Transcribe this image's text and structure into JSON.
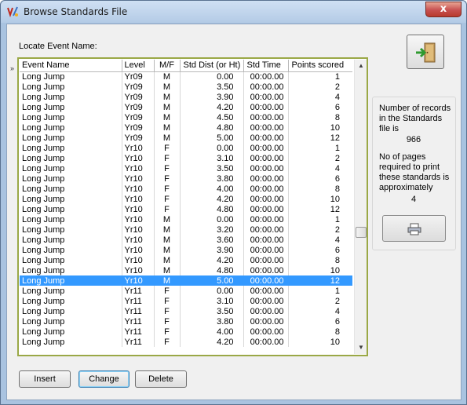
{
  "window": {
    "title": "Browse Standards File",
    "close_glyph": "x"
  },
  "locate": {
    "label": "Locate Event Name:"
  },
  "grid": {
    "columns": [
      "Event Name",
      "Level",
      "M/F",
      "Std Dist (or Ht)",
      "Std Time",
      "Points scored"
    ],
    "row_indicator": "»",
    "selected_index": 20,
    "rows": [
      [
        "Long Jump",
        "Yr09",
        "M",
        "0.00",
        "00:00.00",
        "1"
      ],
      [
        "Long Jump",
        "Yr09",
        "M",
        "3.50",
        "00:00.00",
        "2"
      ],
      [
        "Long Jump",
        "Yr09",
        "M",
        "3.90",
        "00:00.00",
        "4"
      ],
      [
        "Long Jump",
        "Yr09",
        "M",
        "4.20",
        "00:00.00",
        "6"
      ],
      [
        "Long Jump",
        "Yr09",
        "M",
        "4.50",
        "00:00.00",
        "8"
      ],
      [
        "Long Jump",
        "Yr09",
        "M",
        "4.80",
        "00:00.00",
        "10"
      ],
      [
        "Long Jump",
        "Yr09",
        "M",
        "5.00",
        "00:00.00",
        "12"
      ],
      [
        "Long Jump",
        "Yr10",
        "F",
        "0.00",
        "00:00.00",
        "1"
      ],
      [
        "Long Jump",
        "Yr10",
        "F",
        "3.10",
        "00:00.00",
        "2"
      ],
      [
        "Long Jump",
        "Yr10",
        "F",
        "3.50",
        "00:00.00",
        "4"
      ],
      [
        "Long Jump",
        "Yr10",
        "F",
        "3.80",
        "00:00.00",
        "6"
      ],
      [
        "Long Jump",
        "Yr10",
        "F",
        "4.00",
        "00:00.00",
        "8"
      ],
      [
        "Long Jump",
        "Yr10",
        "F",
        "4.20",
        "00:00.00",
        "10"
      ],
      [
        "Long Jump",
        "Yr10",
        "F",
        "4.80",
        "00:00.00",
        "12"
      ],
      [
        "Long Jump",
        "Yr10",
        "M",
        "0.00",
        "00:00.00",
        "1"
      ],
      [
        "Long Jump",
        "Yr10",
        "M",
        "3.20",
        "00:00.00",
        "2"
      ],
      [
        "Long Jump",
        "Yr10",
        "M",
        "3.60",
        "00:00.00",
        "4"
      ],
      [
        "Long Jump",
        "Yr10",
        "M",
        "3.90",
        "00:00.00",
        "6"
      ],
      [
        "Long Jump",
        "Yr10",
        "M",
        "4.20",
        "00:00.00",
        "8"
      ],
      [
        "Long Jump",
        "Yr10",
        "M",
        "4.80",
        "00:00.00",
        "10"
      ],
      [
        "Long Jump",
        "Yr10",
        "M",
        "5.00",
        "00:00.00",
        "12"
      ],
      [
        "Long Jump",
        "Yr11",
        "F",
        "0.00",
        "00:00.00",
        "1"
      ],
      [
        "Long Jump",
        "Yr11",
        "F",
        "3.10",
        "00:00.00",
        "2"
      ],
      [
        "Long Jump",
        "Yr11",
        "F",
        "3.50",
        "00:00.00",
        "4"
      ],
      [
        "Long Jump",
        "Yr11",
        "F",
        "3.80",
        "00:00.00",
        "6"
      ],
      [
        "Long Jump",
        "Yr11",
        "F",
        "4.00",
        "00:00.00",
        "8"
      ],
      [
        "Long Jump",
        "Yr11",
        "F",
        "4.20",
        "00:00.00",
        "10"
      ]
    ],
    "scroll_position": 0.6
  },
  "info": {
    "records_text": "Number of records in the Standards file is",
    "records_count": "966",
    "pages_text": "No of pages required to print these standards is approximately",
    "pages_count": "4"
  },
  "buttons": {
    "insert": "Insert",
    "change": "Change",
    "delete": "Delete"
  },
  "icons": {
    "app": "app-icon",
    "exit": "exit-door-icon",
    "print": "printer-icon"
  },
  "colors": {
    "selection": "#3399ff",
    "grid_border": "#9aa846",
    "titlebar": "#b4cbe6",
    "close": "#c75050"
  }
}
